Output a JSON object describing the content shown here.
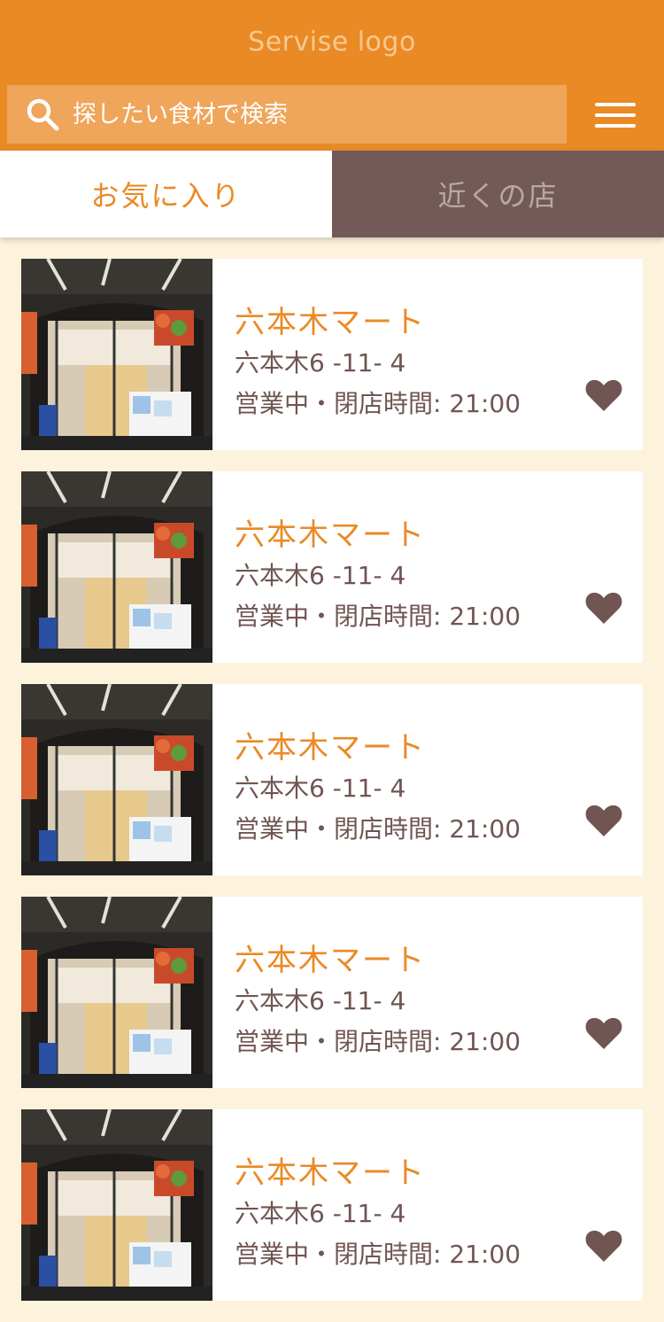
{
  "header": {
    "logo": "Servise logo",
    "search_placeholder": "探したい食材で検索"
  },
  "tabs": [
    {
      "label": "お気に入り",
      "active": true
    },
    {
      "label": "近くの店",
      "active": false
    }
  ],
  "stores": [
    {
      "name": "六本木マート",
      "address": "六本木6 -11- 4",
      "status": "営業中・閉店時間: 21:00"
    },
    {
      "name": "六本木マート",
      "address": "六本木6 -11- 4",
      "status": "営業中・閉店時間: 21:00"
    },
    {
      "name": "六本木マート",
      "address": "六本木6 -11- 4",
      "status": "営業中・閉店時間: 21:00"
    },
    {
      "name": "六本木マート",
      "address": "六本木6 -11- 4",
      "status": "営業中・閉店時間: 21:00"
    },
    {
      "name": "六本木マート",
      "address": "六本木6 -11- 4",
      "status": "営業中・閉店時間: 21:00"
    }
  ],
  "colors": {
    "brand": "#ea8a25",
    "tab_inactive_bg": "#735a58",
    "text_brown": "#705552",
    "background": "#fdf3dd"
  },
  "icons": {
    "search": "search-icon",
    "menu": "hamburger-menu-icon",
    "favorite": "heart-icon"
  }
}
